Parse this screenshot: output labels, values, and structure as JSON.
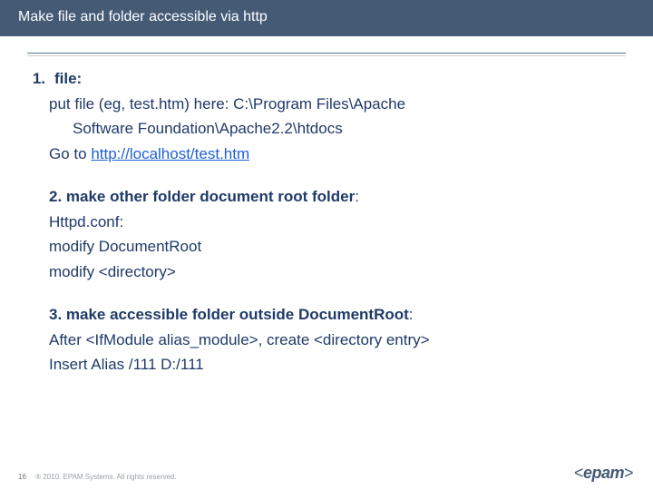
{
  "title": "Make file and folder accessible via http",
  "list": {
    "item1_num": "1.",
    "item1_label": "file:",
    "item1_line1a": "put file (eg, test.htm) here: C:\\Program Files\\Apache",
    "item1_line1b": "Software Foundation\\Apache2.2\\htdocs",
    "item1_goto": "Go to ",
    "item1_link": "http://localhost/test.htm",
    "item2_label": "2. make other folder document root folder",
    "item2_colon": ":",
    "item2_l1": "Httpd.conf:",
    "item2_l2": " modify DocumentRoot",
    "item2_l3": "modify <directory>",
    "item3_label": "3. make accessible folder outside DocumentRoot",
    "item3_colon": ":",
    "item3_l1": "After <IfModule alias_module>, create <directory entry>",
    "item3_l2": "Insert Alias /111 D:/111"
  },
  "footer": {
    "page": "16",
    "copyright": "® 2010. EPAM Systems. All rights reserved."
  },
  "logo": {
    "lt": "<",
    "name": "epam",
    "gt": ">"
  }
}
